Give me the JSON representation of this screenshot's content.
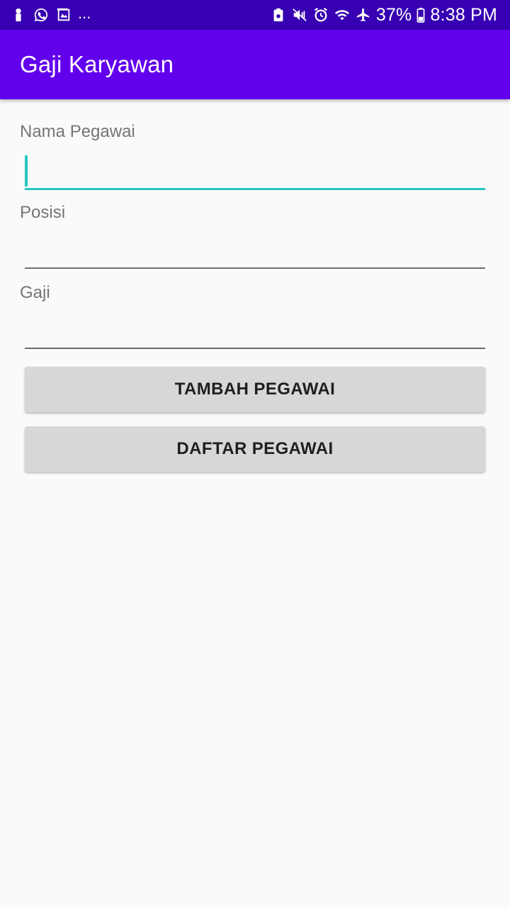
{
  "status_bar": {
    "left_icons": [
      "notification-person-icon",
      "whatsapp-icon",
      "gallery-icon"
    ],
    "overflow": "...",
    "right_icons": [
      "battery-saver-icon",
      "mute-icon",
      "alarm-icon",
      "wifi-icon",
      "airplane-icon"
    ],
    "battery": "37%",
    "time": "8:38 PM"
  },
  "app_bar": {
    "title": "Gaji Karyawan",
    "color": "#6200ee",
    "status_color": "#3700b3"
  },
  "form": {
    "nama": {
      "label": "Nama Pegawai",
      "value": ""
    },
    "posisi": {
      "label": "Posisi",
      "value": ""
    },
    "gaji": {
      "label": "Gaji",
      "value": ""
    },
    "accent": "#26c6c0"
  },
  "buttons": {
    "tambah": "TAMBAH PEGAWAI",
    "daftar": "DAFTAR PEGAWAI"
  }
}
